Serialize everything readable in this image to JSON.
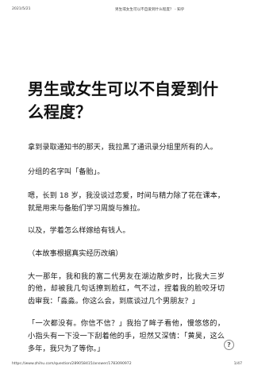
{
  "header": {
    "date": "2021/5/21",
    "doc_title": "男生或女生可以不自爱到什么程度？ - 知乎"
  },
  "article": {
    "title": "男生或女生可以不自爱到什么程度？",
    "paragraphs": [
      "拿到录取通知书的那天，我拉黑了通讯录分组里所有的人。",
      "分组的名字叫「备胎」。",
      "嗯，长到 18 岁，我没谈过恋爱，时间与精力除了花在课本，就是用来与备胎们学习周旋与推拉。",
      "以及，学着怎么样嫁给有钱人。",
      "（本故事根据真实经历改编）",
      "大一那年，我和我的富二代男友在湖边散步时，比我大三岁的他，却被我几句话撩到脸红，气不过，捏着我的脸咬牙切齿审我：「淼淼。你这么会，到底谈过几个男朋友？」",
      "「一次都没有。你信不信？」我抬了眸子看他，慢悠悠的，小指头有一下没一下刮着他的手，坦然又深情：「黄昊，这么多年，我只为了等你。」"
    ]
  },
  "help_icon": "question-mark-icon",
  "help_glyph": "?",
  "footer": {
    "url": "https://www.zhihu.com/question/289058415/answer/1783090972",
    "page": "1/47"
  }
}
